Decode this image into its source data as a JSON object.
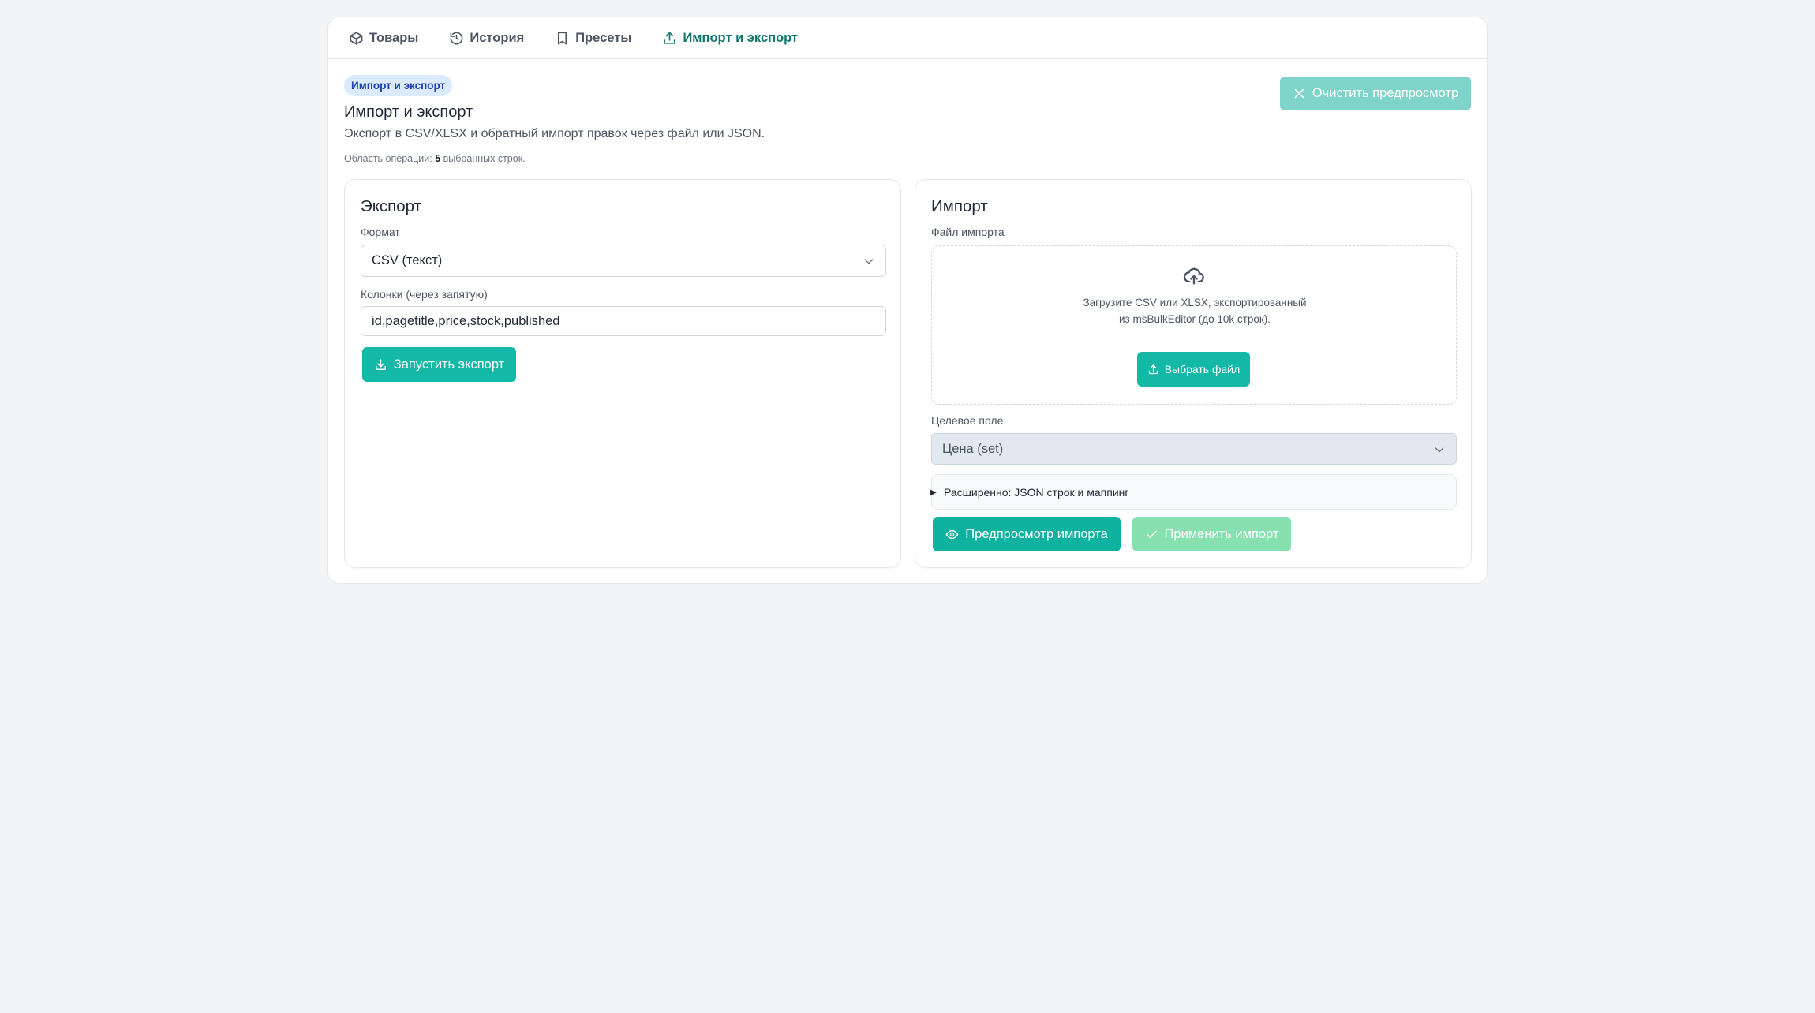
{
  "tabs": [
    {
      "label": "Товары",
      "icon": "box-icon",
      "active": false
    },
    {
      "label": "История",
      "icon": "history-icon",
      "active": false
    },
    {
      "label": "Пресеты",
      "icon": "bookmark-icon",
      "active": false
    },
    {
      "label": "Импорт и экспорт",
      "icon": "upload-icon",
      "active": true
    }
  ],
  "header": {
    "badge": "Импорт и экспорт",
    "title": "Импорт и экспорт",
    "subtitle": "Экспорт в CSV/XLSX и обратный импорт правок через файл или JSON.",
    "scope_prefix": "Область операции:",
    "scope_count": "5",
    "scope_suffix": "выбранных строк.",
    "clear_preview_label": "Очистить предпросмотр"
  },
  "export": {
    "title": "Экспорт",
    "format_label": "Формат",
    "format_value": "CSV (текст)",
    "columns_label": "Колонки (через запятую)",
    "columns_value": "id,pagetitle,price,stock,published",
    "run_label": "Запустить экспорт"
  },
  "import": {
    "title": "Импорт",
    "file_label": "Файл импорта",
    "dropzone_text": "Загрузите CSV или XLSX, экспортированный из msBulkEditor (до 10k строк).",
    "choose_file_label": "Выбрать файл",
    "target_label": "Целевое поле",
    "target_value": "Цена (set)",
    "advanced_label": "Расширенно: JSON строк и маппинг",
    "preview_label": "Предпросмотр импорта",
    "apply_label": "Применить импорт"
  },
  "colors": {
    "accent": "#14b8a6",
    "accent_dark": "#0f766e",
    "badge_bg": "#dbeafe",
    "badge_text": "#1e40af",
    "disabled_apply": "#86e0b0",
    "disabled_clear": "#7fd4c9"
  }
}
